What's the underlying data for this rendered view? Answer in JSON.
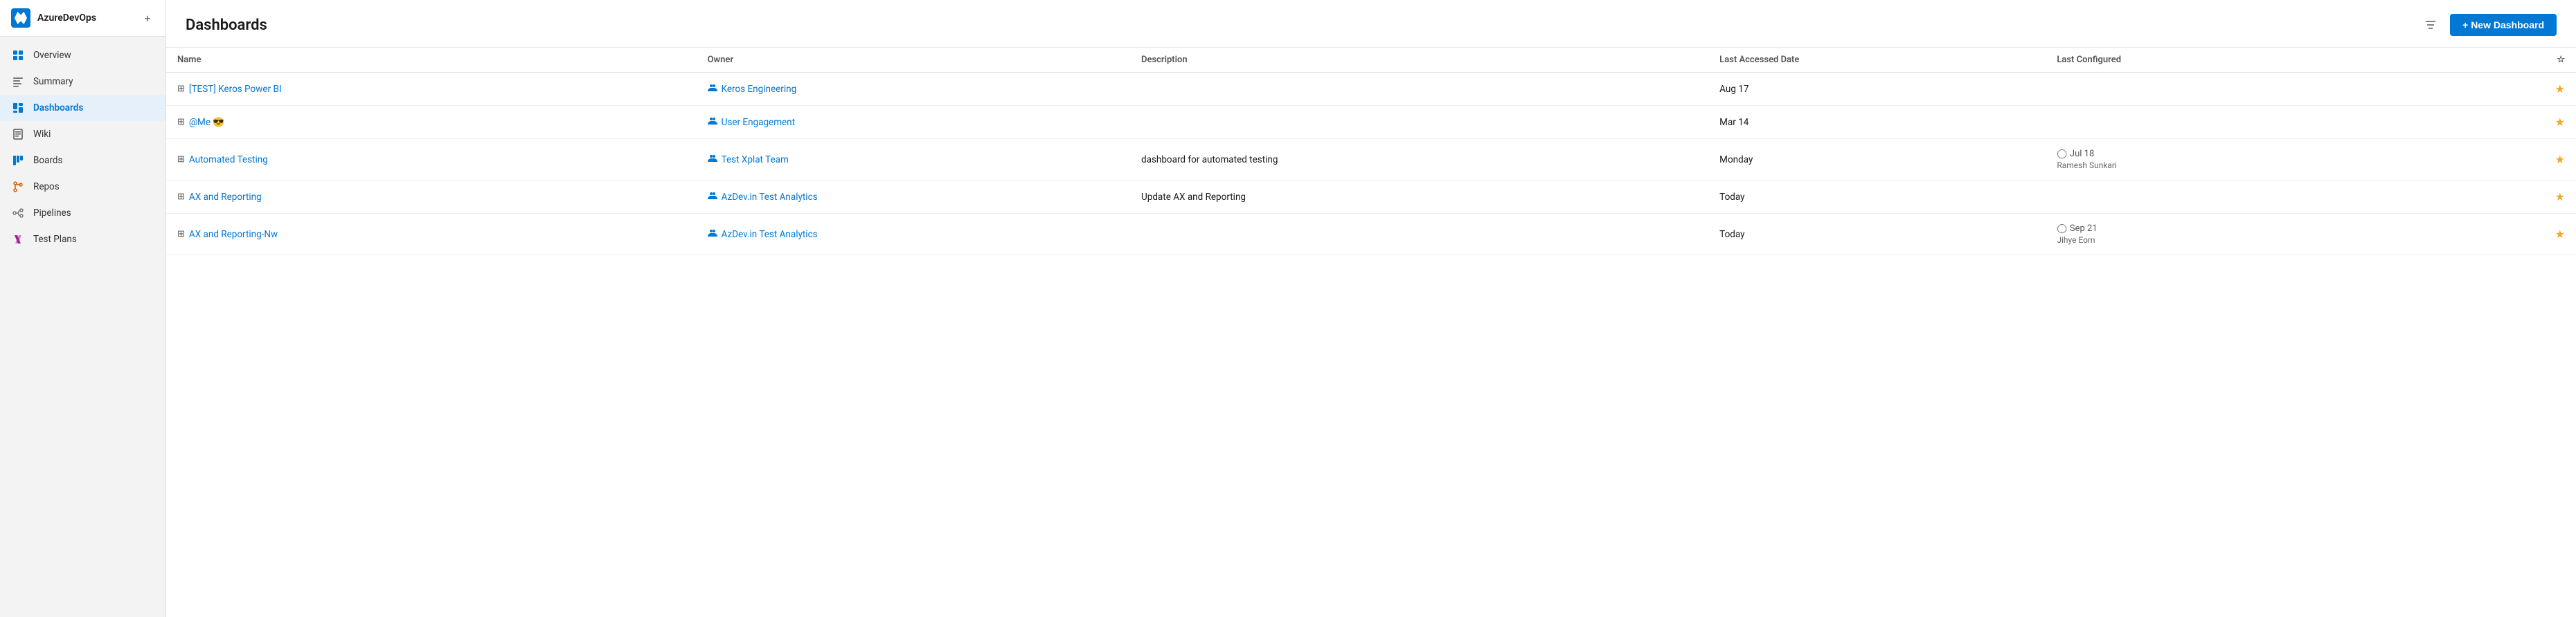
{
  "sidebar": {
    "org_name": "AzureDevOps",
    "add_label": "+",
    "nav_items": [
      {
        "id": "overview",
        "label": "Overview",
        "icon": "overview",
        "active": false
      },
      {
        "id": "summary",
        "label": "Summary",
        "icon": "summary",
        "active": false
      },
      {
        "id": "dashboards",
        "label": "Dashboards",
        "icon": "dashboards",
        "active": true
      },
      {
        "id": "wiki",
        "label": "Wiki",
        "icon": "wiki",
        "active": false
      },
      {
        "id": "boards",
        "label": "Boards",
        "icon": "boards",
        "active": false
      },
      {
        "id": "repos",
        "label": "Repos",
        "icon": "repos",
        "active": false
      },
      {
        "id": "pipelines",
        "label": "Pipelines",
        "icon": "pipelines",
        "active": false
      },
      {
        "id": "testplans",
        "label": "Test Plans",
        "icon": "testplans",
        "active": false
      }
    ]
  },
  "header": {
    "title": "Dashboards",
    "new_dashboard_label": "+ New Dashboard"
  },
  "table": {
    "columns": {
      "name": "Name",
      "owner": "Owner",
      "description": "Description",
      "last_accessed": "Last Accessed Date",
      "last_configured": "Last Configured",
      "star": "☆"
    },
    "rows": [
      {
        "name": "[TEST] Keros Power BI",
        "owner": "Keros Engineering",
        "description": "",
        "last_accessed": "Aug 17",
        "last_configured_date": "",
        "last_configured_user": "",
        "starred": true
      },
      {
        "name": "@Me 😎",
        "owner": "User Engagement",
        "description": "",
        "last_accessed": "Mar 14",
        "last_configured_date": "",
        "last_configured_user": "",
        "starred": true
      },
      {
        "name": "Automated Testing",
        "owner": "Test Xplat Team",
        "description": "dashboard for automated testing",
        "last_accessed": "Monday",
        "last_configured_date": "Jul 18",
        "last_configured_user": "Ramesh Sunkari",
        "starred": true
      },
      {
        "name": "AX and Reporting",
        "owner": "AzDev.in Test Analytics",
        "description": "Update AX and Reporting",
        "last_accessed": "Today",
        "last_configured_date": "",
        "last_configured_user": "",
        "starred": true
      },
      {
        "name": "AX and Reporting-Nw",
        "owner": "AzDev.in Test Analytics",
        "description": "",
        "last_accessed": "Today",
        "last_configured_date": "Sep 21",
        "last_configured_user": "Jihye Eom",
        "starred": true
      }
    ]
  }
}
